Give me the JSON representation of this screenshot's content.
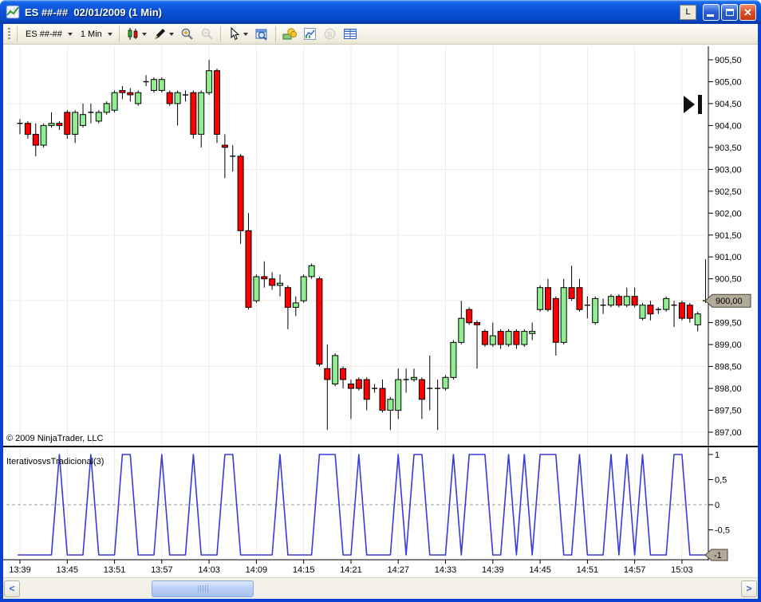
{
  "window": {
    "title": "ES ##-##  02/01/2009 (1 Min)",
    "l_button_label": "L",
    "titlebar_color": "#0b52d6",
    "border_color": "#0a41d1"
  },
  "toolbar": {
    "instrument_label": "ES ##-##",
    "interval_label": "1 Min",
    "buttons": [
      {
        "name": "instrument-selector",
        "label": "ES ##-##",
        "has_dropdown": true,
        "enabled": true
      },
      {
        "name": "interval-selector",
        "label": "1 Min",
        "has_dropdown": true,
        "enabled": true
      },
      {
        "name": "chart-style",
        "icon": "candlestick-icon",
        "has_dropdown": true,
        "enabled": true
      },
      {
        "name": "draw-tool",
        "icon": "pencil-icon",
        "has_dropdown": true,
        "enabled": true
      },
      {
        "name": "zoom-in",
        "icon": "zoom-in-icon",
        "has_dropdown": false,
        "enabled": true
      },
      {
        "name": "zoom-out",
        "icon": "zoom-out-icon",
        "has_dropdown": false,
        "enabled": false
      },
      {
        "name": "cursor",
        "icon": "cursor-icon",
        "has_dropdown": true,
        "enabled": true
      },
      {
        "name": "data-box",
        "icon": "data-box-icon",
        "has_dropdown": false,
        "enabled": true
      },
      {
        "name": "trade",
        "icon": "coins-icon",
        "has_dropdown": false,
        "enabled": true
      },
      {
        "name": "chart-trader",
        "icon": "mini-chart-icon",
        "has_dropdown": false,
        "enabled": true
      },
      {
        "name": "currency",
        "icon": "dollar-icon",
        "has_dropdown": false,
        "enabled": false
      },
      {
        "name": "data-grid",
        "icon": "grid-icon",
        "has_dropdown": false,
        "enabled": true
      }
    ]
  },
  "footer": {
    "copyright": "© 2009 NinjaTrader, LLC"
  },
  "colors": {
    "grid": "#f2ebe1",
    "axis_text": "#000000",
    "tag_bg": "#b3ab9a",
    "tag_border": "#454134",
    "marker": "#111111",
    "indicator_line": "#3a3ad9"
  },
  "chart_data": [
    {
      "type": "candlestick",
      "title": "ES ##-## 02/01/2009 (1 Min)",
      "y_min": 897.0,
      "y_max": 905.5,
      "y_tick_step": 0.5,
      "grid_levels": [
        904.5,
        903.0,
        901.5,
        900.0,
        898.5,
        897.0
      ],
      "y_tick_labels": [
        "905,50",
        "905,00",
        "904,50",
        "904,00",
        "903,50",
        "903,00",
        "902,50",
        "902,00",
        "901,50",
        "901,00",
        "900,50",
        "900,00",
        "899,50",
        "899,00",
        "898,50",
        "898,00",
        "897,50",
        "897,00"
      ],
      "x_tick_labels": [
        "13:39",
        "13:45",
        "13:51",
        "13:57",
        "14:03",
        "14:09",
        "14:15",
        "14:21",
        "14:27",
        "14:33",
        "14:39",
        "14:45",
        "14:51",
        "14:57",
        "15:03"
      ],
      "x_tick_every_n_bars": 6,
      "up_color": "#90ee90",
      "down_color": "#ff0000",
      "last_price_label": "900,00",
      "candles": [
        [
          904.05,
          904.15,
          903.8,
          904.05
        ],
        [
          904.05,
          904.1,
          903.7,
          903.8
        ],
        [
          903.8,
          904.05,
          903.3,
          903.55
        ],
        [
          903.55,
          904.05,
          903.5,
          904.0
        ],
        [
          904.0,
          904.3,
          903.95,
          904.05
        ],
        [
          904.05,
          904.1,
          903.9,
          904.0
        ],
        [
          904.3,
          904.35,
          903.7,
          903.8
        ],
        [
          903.8,
          904.35,
          903.6,
          904.3
        ],
        [
          904.0,
          904.5,
          903.95,
          904.25
        ],
        [
          904.3,
          904.5,
          904.05,
          904.3
        ],
        [
          904.1,
          904.35,
          904.05,
          904.3
        ],
        [
          904.3,
          904.55,
          904.25,
          904.5
        ],
        [
          904.35,
          904.8,
          904.3,
          904.75
        ],
        [
          904.8,
          904.9,
          904.6,
          904.75
        ],
        [
          904.75,
          904.85,
          904.55,
          904.7
        ],
        [
          904.5,
          904.8,
          904.45,
          904.75
        ],
        [
          905.0,
          905.15,
          904.9,
          905.0
        ],
        [
          904.8,
          905.1,
          904.75,
          905.05
        ],
        [
          904.8,
          905.1,
          904.75,
          905.05
        ],
        [
          904.75,
          904.8,
          904.45,
          904.5
        ],
        [
          904.5,
          904.8,
          904.0,
          904.75
        ],
        [
          904.7,
          904.8,
          904.55,
          904.7
        ],
        [
          904.75,
          904.8,
          903.7,
          903.8
        ],
        [
          903.8,
          904.8,
          903.5,
          904.75
        ],
        [
          904.75,
          905.5,
          904.7,
          905.25
        ],
        [
          905.25,
          905.3,
          903.6,
          903.8
        ],
        [
          903.55,
          903.8,
          902.8,
          903.5
        ],
        [
          903.3,
          903.55,
          902.95,
          903.3
        ],
        [
          903.3,
          903.35,
          901.3,
          901.6
        ],
        [
          901.6,
          902.0,
          899.8,
          899.85
        ],
        [
          900.0,
          900.6,
          899.95,
          900.55
        ],
        [
          900.55,
          900.9,
          900.3,
          900.5
        ],
        [
          900.5,
          900.65,
          900.25,
          900.35
        ],
        [
          900.35,
          900.6,
          900.1,
          900.4
        ],
        [
          900.3,
          900.35,
          899.35,
          899.85
        ],
        [
          899.85,
          900.1,
          899.65,
          899.95
        ],
        [
          900.0,
          900.6,
          899.95,
          900.55
        ],
        [
          900.55,
          900.85,
          900.5,
          900.8
        ],
        [
          900.5,
          900.55,
          898.5,
          898.55
        ],
        [
          898.45,
          899.0,
          897.05,
          898.2
        ],
        [
          898.1,
          898.8,
          898.05,
          898.75
        ],
        [
          898.45,
          898.5,
          898.0,
          898.2
        ],
        [
          898.1,
          898.2,
          897.3,
          898.0
        ],
        [
          898.2,
          898.25,
          897.95,
          898.0
        ],
        [
          898.2,
          898.25,
          897.5,
          897.75
        ],
        [
          898.0,
          898.1,
          897.9,
          898.0
        ],
        [
          898.0,
          898.2,
          897.45,
          897.5
        ],
        [
          897.5,
          897.8,
          897.05,
          897.75
        ],
        [
          897.5,
          898.45,
          897.3,
          898.2
        ],
        [
          898.2,
          898.45,
          897.9,
          898.2
        ],
        [
          898.2,
          898.45,
          898.15,
          898.25
        ],
        [
          898.2,
          898.25,
          897.3,
          897.75
        ],
        [
          898.0,
          898.75,
          897.5,
          898.0
        ],
        [
          898.0,
          898.2,
          897.05,
          898.0
        ],
        [
          898.0,
          898.3,
          897.95,
          898.25
        ],
        [
          898.25,
          899.1,
          898.2,
          899.05
        ],
        [
          899.05,
          900.0,
          899.0,
          899.6
        ],
        [
          899.8,
          899.85,
          899.45,
          899.5
        ],
        [
          899.5,
          899.55,
          898.45,
          899.45
        ],
        [
          899.3,
          899.35,
          898.95,
          899.0
        ],
        [
          899.0,
          899.5,
          898.95,
          899.2
        ],
        [
          899.3,
          899.35,
          898.9,
          899.0
        ],
        [
          899.0,
          899.35,
          898.95,
          899.3
        ],
        [
          899.3,
          899.35,
          898.9,
          899.0
        ],
        [
          899.0,
          899.35,
          898.95,
          899.3
        ],
        [
          899.25,
          899.5,
          899.1,
          899.3
        ],
        [
          899.8,
          900.35,
          899.75,
          900.3
        ],
        [
          900.3,
          900.5,
          899.75,
          899.8
        ],
        [
          900.05,
          900.1,
          898.75,
          899.05
        ],
        [
          899.05,
          900.5,
          899.0,
          900.3
        ],
        [
          900.3,
          900.8,
          900.0,
          900.05
        ],
        [
          900.3,
          900.5,
          899.75,
          899.8
        ],
        [
          899.9,
          900.1,
          899.6,
          899.9
        ],
        [
          899.5,
          900.1,
          899.45,
          900.05
        ],
        [
          899.9,
          900.05,
          899.7,
          899.9
        ],
        [
          899.9,
          900.15,
          899.85,
          900.1
        ],
        [
          900.1,
          900.15,
          899.85,
          899.9
        ],
        [
          899.9,
          900.3,
          899.85,
          900.1
        ],
        [
          900.1,
          900.3,
          899.85,
          899.9
        ],
        [
          899.6,
          899.95,
          899.55,
          899.9
        ],
        [
          899.9,
          900.0,
          899.55,
          899.7
        ],
        [
          899.8,
          899.85,
          899.7,
          899.8
        ],
        [
          899.8,
          900.1,
          899.75,
          900.05
        ],
        [
          899.9,
          900.0,
          899.4,
          899.9
        ],
        [
          899.95,
          900.0,
          899.55,
          899.6
        ],
        [
          899.9,
          899.95,
          899.5,
          899.6
        ],
        [
          899.45,
          899.75,
          899.3,
          899.7
        ],
        [
          900.0,
          900.95,
          899.95,
          900.0
        ]
      ]
    },
    {
      "type": "line",
      "name": "IterativosvsTradicional(3)",
      "color": "#3a3ad9",
      "y_min": -1,
      "y_max": 1,
      "y_tick_values": [
        1,
        0.5,
        0,
        -0.5
      ],
      "y_tick_labels": [
        "1",
        "0,5",
        "0",
        "-0,5"
      ],
      "zero_line_dashed": true,
      "last_value_label": "-1",
      "values": [
        -1,
        -1,
        -1,
        -1,
        -1,
        1,
        -1,
        -1,
        -1,
        1,
        -1,
        -1,
        -1,
        1,
        1,
        -1,
        -1,
        -1,
        1,
        -1,
        -1,
        -1,
        1,
        -1,
        -1,
        -1,
        1,
        1,
        -1,
        -1,
        -1,
        -1,
        -1,
        1,
        -1,
        -1,
        -1,
        -1,
        1,
        1,
        1,
        -1,
        -1,
        1,
        -1,
        -1,
        -1,
        -1,
        1,
        -1,
        1,
        1,
        -1,
        -1,
        -1,
        1,
        -1,
        1,
        1,
        1,
        -1,
        -1,
        1,
        -1,
        1,
        -1,
        1,
        1,
        1,
        -1,
        -1,
        1,
        -1,
        -1,
        -1,
        1,
        -1,
        1,
        -1,
        1,
        -1,
        -1,
        -1,
        1,
        1,
        -1,
        -1,
        -1
      ]
    }
  ]
}
